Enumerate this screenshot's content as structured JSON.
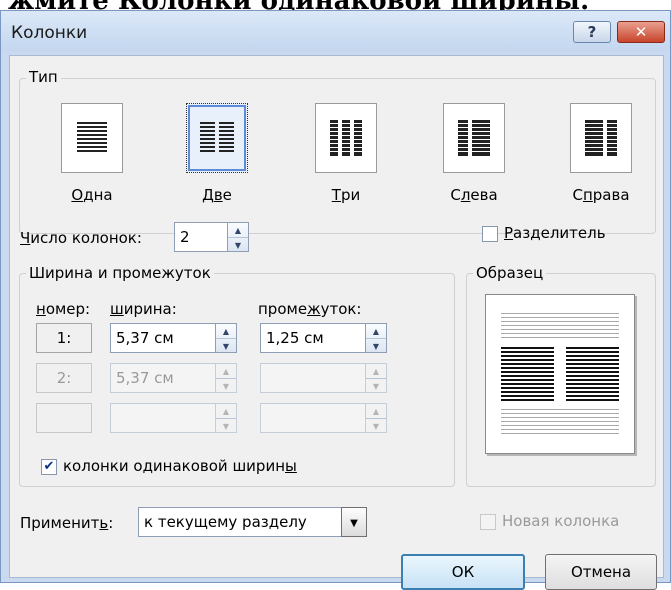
{
  "background_text": "жмите Колонки одинаковой ширины.",
  "window": {
    "title": "Колонки",
    "help_label": "?",
    "close_label": "✕"
  },
  "type_group": {
    "label": "Тип",
    "options": [
      {
        "label_u": "О",
        "label_rest": "дна",
        "icon": "one-column-icon",
        "selected": false
      },
      {
        "label_pre": "Д",
        "label_u": "в",
        "label_rest": "е",
        "icon": "two-columns-icon",
        "selected": true
      },
      {
        "label_u": "Т",
        "label_rest": "ри",
        "icon": "three-columns-icon",
        "selected": false
      },
      {
        "label_pre": "С",
        "label_u": "л",
        "label_rest": "ева",
        "icon": "left-column-icon",
        "selected": false
      },
      {
        "label_pre": "С",
        "label_u": "п",
        "label_rest": "рава",
        "icon": "right-column-icon",
        "selected": false
      }
    ]
  },
  "num_columns": {
    "label_u": "Ч",
    "label_rest": "исло колонок:",
    "value": "2"
  },
  "separator": {
    "label_u": "Р",
    "label_rest": "азделитель",
    "checked": false
  },
  "width_group": {
    "label": "Ширина и промежуток",
    "col_number_label_u": "н",
    "col_number_label_rest": "омер:",
    "col_width_label_u": "ш",
    "col_width_label_rest": "ирина:",
    "col_spacing_label_pre": "проме",
    "col_spacing_label_u": "ж",
    "col_spacing_label_rest": "уток:",
    "rows": [
      {
        "number": "1:",
        "width": "5,37 см",
        "spacing": "1,25 см",
        "enabled": true
      },
      {
        "number": "2:",
        "width": "5,37 см",
        "spacing": "",
        "enabled": false
      },
      {
        "number": "",
        "width": "",
        "spacing": "",
        "enabled": false
      }
    ],
    "equal_width": {
      "label_pre": "колонки одинаковой ширин",
      "label_u": "ы",
      "checked": true
    }
  },
  "preview": {
    "label": "Образец"
  },
  "apply_to": {
    "label_pre": "Применит",
    "label_u": "ь",
    "label_rest": ":",
    "value": "к текущему разделу"
  },
  "new_column": {
    "label": "Новая колонка",
    "checked": false,
    "enabled": false
  },
  "buttons": {
    "ok": "ОК",
    "cancel": "Отмена"
  },
  "colors": {
    "dialog_bg": "#f0f0f0",
    "title_bg": "#c9daf0",
    "accent": "#3c7fb1",
    "close": "#c8452c"
  }
}
